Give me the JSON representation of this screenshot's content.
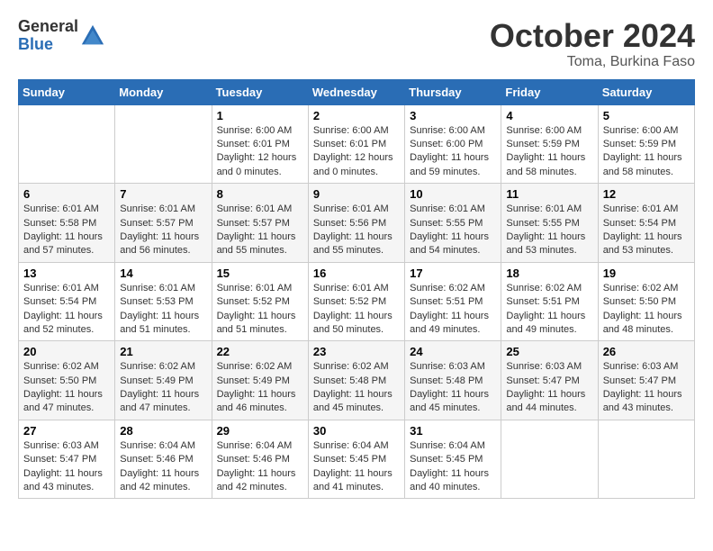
{
  "logo": {
    "general": "General",
    "blue": "Blue"
  },
  "title": "October 2024",
  "subtitle": "Toma, Burkina Faso",
  "headers": [
    "Sunday",
    "Monday",
    "Tuesday",
    "Wednesday",
    "Thursday",
    "Friday",
    "Saturday"
  ],
  "weeks": [
    [
      {
        "day": "",
        "lines": []
      },
      {
        "day": "",
        "lines": []
      },
      {
        "day": "1",
        "lines": [
          "Sunrise: 6:00 AM",
          "Sunset: 6:01 PM",
          "Daylight: 12 hours",
          "and 0 minutes."
        ]
      },
      {
        "day": "2",
        "lines": [
          "Sunrise: 6:00 AM",
          "Sunset: 6:01 PM",
          "Daylight: 12 hours",
          "and 0 minutes."
        ]
      },
      {
        "day": "3",
        "lines": [
          "Sunrise: 6:00 AM",
          "Sunset: 6:00 PM",
          "Daylight: 11 hours",
          "and 59 minutes."
        ]
      },
      {
        "day": "4",
        "lines": [
          "Sunrise: 6:00 AM",
          "Sunset: 5:59 PM",
          "Daylight: 11 hours",
          "and 58 minutes."
        ]
      },
      {
        "day": "5",
        "lines": [
          "Sunrise: 6:00 AM",
          "Sunset: 5:59 PM",
          "Daylight: 11 hours",
          "and 58 minutes."
        ]
      }
    ],
    [
      {
        "day": "6",
        "lines": [
          "Sunrise: 6:01 AM",
          "Sunset: 5:58 PM",
          "Daylight: 11 hours",
          "and 57 minutes."
        ]
      },
      {
        "day": "7",
        "lines": [
          "Sunrise: 6:01 AM",
          "Sunset: 5:57 PM",
          "Daylight: 11 hours",
          "and 56 minutes."
        ]
      },
      {
        "day": "8",
        "lines": [
          "Sunrise: 6:01 AM",
          "Sunset: 5:57 PM",
          "Daylight: 11 hours",
          "and 55 minutes."
        ]
      },
      {
        "day": "9",
        "lines": [
          "Sunrise: 6:01 AM",
          "Sunset: 5:56 PM",
          "Daylight: 11 hours",
          "and 55 minutes."
        ]
      },
      {
        "day": "10",
        "lines": [
          "Sunrise: 6:01 AM",
          "Sunset: 5:55 PM",
          "Daylight: 11 hours",
          "and 54 minutes."
        ]
      },
      {
        "day": "11",
        "lines": [
          "Sunrise: 6:01 AM",
          "Sunset: 5:55 PM",
          "Daylight: 11 hours",
          "and 53 minutes."
        ]
      },
      {
        "day": "12",
        "lines": [
          "Sunrise: 6:01 AM",
          "Sunset: 5:54 PM",
          "Daylight: 11 hours",
          "and 53 minutes."
        ]
      }
    ],
    [
      {
        "day": "13",
        "lines": [
          "Sunrise: 6:01 AM",
          "Sunset: 5:54 PM",
          "Daylight: 11 hours",
          "and 52 minutes."
        ]
      },
      {
        "day": "14",
        "lines": [
          "Sunrise: 6:01 AM",
          "Sunset: 5:53 PM",
          "Daylight: 11 hours",
          "and 51 minutes."
        ]
      },
      {
        "day": "15",
        "lines": [
          "Sunrise: 6:01 AM",
          "Sunset: 5:52 PM",
          "Daylight: 11 hours",
          "and 51 minutes."
        ]
      },
      {
        "day": "16",
        "lines": [
          "Sunrise: 6:01 AM",
          "Sunset: 5:52 PM",
          "Daylight: 11 hours",
          "and 50 minutes."
        ]
      },
      {
        "day": "17",
        "lines": [
          "Sunrise: 6:02 AM",
          "Sunset: 5:51 PM",
          "Daylight: 11 hours",
          "and 49 minutes."
        ]
      },
      {
        "day": "18",
        "lines": [
          "Sunrise: 6:02 AM",
          "Sunset: 5:51 PM",
          "Daylight: 11 hours",
          "and 49 minutes."
        ]
      },
      {
        "day": "19",
        "lines": [
          "Sunrise: 6:02 AM",
          "Sunset: 5:50 PM",
          "Daylight: 11 hours",
          "and 48 minutes."
        ]
      }
    ],
    [
      {
        "day": "20",
        "lines": [
          "Sunrise: 6:02 AM",
          "Sunset: 5:50 PM",
          "Daylight: 11 hours",
          "and 47 minutes."
        ]
      },
      {
        "day": "21",
        "lines": [
          "Sunrise: 6:02 AM",
          "Sunset: 5:49 PM",
          "Daylight: 11 hours",
          "and 47 minutes."
        ]
      },
      {
        "day": "22",
        "lines": [
          "Sunrise: 6:02 AM",
          "Sunset: 5:49 PM",
          "Daylight: 11 hours",
          "and 46 minutes."
        ]
      },
      {
        "day": "23",
        "lines": [
          "Sunrise: 6:02 AM",
          "Sunset: 5:48 PM",
          "Daylight: 11 hours",
          "and 45 minutes."
        ]
      },
      {
        "day": "24",
        "lines": [
          "Sunrise: 6:03 AM",
          "Sunset: 5:48 PM",
          "Daylight: 11 hours",
          "and 45 minutes."
        ]
      },
      {
        "day": "25",
        "lines": [
          "Sunrise: 6:03 AM",
          "Sunset: 5:47 PM",
          "Daylight: 11 hours",
          "and 44 minutes."
        ]
      },
      {
        "day": "26",
        "lines": [
          "Sunrise: 6:03 AM",
          "Sunset: 5:47 PM",
          "Daylight: 11 hours",
          "and 43 minutes."
        ]
      }
    ],
    [
      {
        "day": "27",
        "lines": [
          "Sunrise: 6:03 AM",
          "Sunset: 5:47 PM",
          "Daylight: 11 hours",
          "and 43 minutes."
        ]
      },
      {
        "day": "28",
        "lines": [
          "Sunrise: 6:04 AM",
          "Sunset: 5:46 PM",
          "Daylight: 11 hours",
          "and 42 minutes."
        ]
      },
      {
        "day": "29",
        "lines": [
          "Sunrise: 6:04 AM",
          "Sunset: 5:46 PM",
          "Daylight: 11 hours",
          "and 42 minutes."
        ]
      },
      {
        "day": "30",
        "lines": [
          "Sunrise: 6:04 AM",
          "Sunset: 5:45 PM",
          "Daylight: 11 hours",
          "and 41 minutes."
        ]
      },
      {
        "day": "31",
        "lines": [
          "Sunrise: 6:04 AM",
          "Sunset: 5:45 PM",
          "Daylight: 11 hours",
          "and 40 minutes."
        ]
      },
      {
        "day": "",
        "lines": []
      },
      {
        "day": "",
        "lines": []
      }
    ]
  ]
}
